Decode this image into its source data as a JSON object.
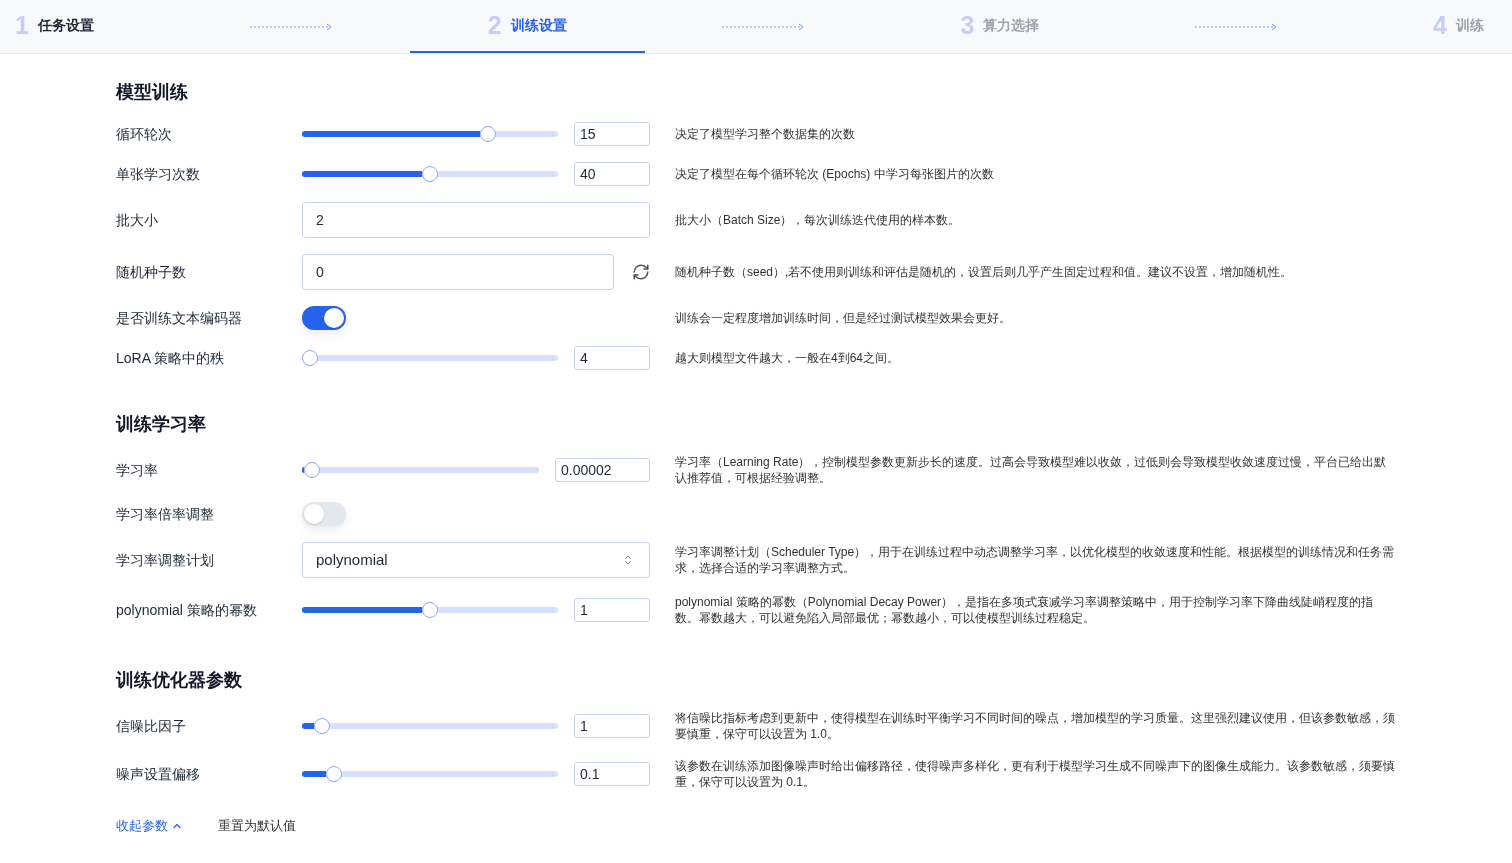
{
  "steps": [
    {
      "number": "1",
      "label": "任务设置",
      "selected": false,
      "completed": true
    },
    {
      "number": "2",
      "label": "训练设置",
      "selected": true,
      "completed": false
    },
    {
      "number": "3",
      "label": "算力选择",
      "selected": false,
      "completed": false
    },
    {
      "number": "4",
      "label": "训练",
      "selected": false,
      "completed": false
    }
  ],
  "sections": [
    {
      "title": "模型训练",
      "rows": [
        {
          "kind": "slider",
          "label": "循环轮次",
          "level": 0.74,
          "value": "15",
          "description": "决定了模型学习整个数据集的次数"
        },
        {
          "kind": "slider",
          "label": "单张学习次数",
          "level": 0.5,
          "value": "40",
          "description": "决定了模型在每个循环轮次 (Epochs) 中学习每张图片的次数"
        },
        {
          "kind": "input",
          "label": "批大小",
          "value": "2",
          "description": "批大小（Batch Size），每次训练迭代使用的样本数。"
        },
        {
          "kind": "input_refresh",
          "label": "随机种子数",
          "value": "0",
          "description": "随机种子数（seed）,若不使用则训练和评估是随机的，设置后则几乎产生固定过程和值。建议不设置，增加随机性。"
        },
        {
          "kind": "toggle",
          "label": "是否训练文本编码器",
          "on": true,
          "description": "训练会一定程度增加训练时间，但是经过测试模型效果会更好。"
        },
        {
          "kind": "slider",
          "label": "LoRA 策略中的秩",
          "level": 0,
          "value": "4",
          "description": "越大则模型文件越大，一般在4到64之间。"
        }
      ]
    },
    {
      "title": "训练学习率",
      "rows": [
        {
          "kind": "slider",
          "label": "学习率",
          "level": 0.01,
          "value": "0.00002",
          "description": "学习率（Learning Rate），控制模型参数更新步长的速度。过高会导致模型难以收敛，过低则会导致模型收敛速度过慢，平台已给出默认推荐值，可根据经验调整。"
        },
        {
          "kind": "toggle",
          "label": "学习率倍率调整",
          "on": false
        },
        {
          "kind": "select",
          "label": "学习率调整计划",
          "value": "polynomial",
          "description": "学习率调整计划（Scheduler Type），用于在训练过程中动态调整学习率，以优化模型的收敛速度和性能。根据模型的训练情况和任务需求，选择合适的学习率调整方式。"
        },
        {
          "kind": "slider",
          "label": "polynomial 策略的幂数",
          "level": 0.5,
          "value": "1",
          "description": "polynomial 策略的幂数（Polynomial Decay Power），是指在多项式衰减学习率调整策略中，用于控制学习率下降曲线陡峭程度的指数。幂数越大，可以避免陷入局部最优；幂数越小，可以使模型训练过程稳定。"
        }
      ]
    },
    {
      "title": "训练优化器参数",
      "rows": [
        {
          "kind": "slider",
          "label": "信噪比因子",
          "level": 0.05,
          "value": "1",
          "description": "将信噪比指标考虑到更新中，使得模型在训练时平衡学习不同时间的噪点，增加模型的学习质量。这里强烈建议使用，但该参数敏感，须要慎重，保守可以设置为 1.0。"
        },
        {
          "kind": "slider",
          "label": "噪声设置偏移",
          "level": 0.1,
          "value": "0.1",
          "description": "该参数在训练添加图像噪声时给出偏移路径，使得噪声多样化，更有利于模型学习生成不同噪声下的图像生成能力。该参数敏感，须要慎重，保守可以设置为 0.1。"
        }
      ]
    }
  ],
  "footer": {
    "collapse_link": "收起参数",
    "reset_button": "重置为默认值"
  }
}
